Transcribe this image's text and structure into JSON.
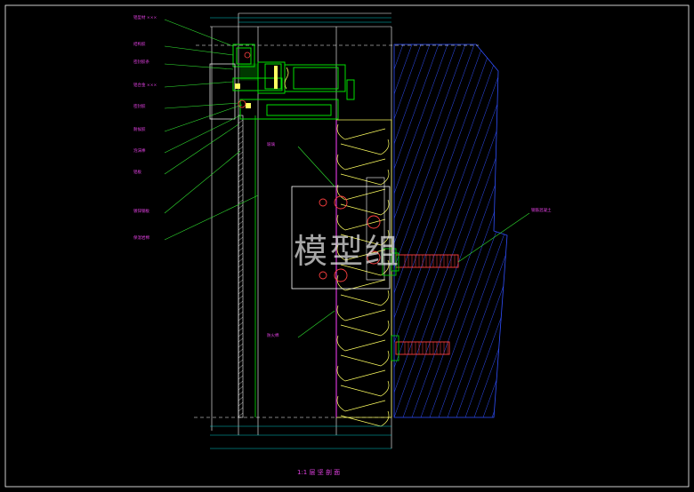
{
  "drawing": {
    "title": "1:1 层 坚 剖 面",
    "watermark": "模型组",
    "annotations": [
      "铝型材 ×××",
      "结构胶",
      "密封胶条",
      "铝合金 ×××",
      "密封胶",
      "耐候胶",
      "泡沫棒",
      "铝板",
      "镀锌钢板",
      "保温岩棉",
      "玻璃",
      "防火棉"
    ],
    "right_label": "钢筋混凝土",
    "colors": {
      "background": "#000000",
      "frame": "#ffffff",
      "aluminum": "#00e000",
      "annotation": "#e040e0",
      "leader": "#30e030",
      "hatch": "#3050ff",
      "dimension": "#00c8c8",
      "insulation": "#ffff60",
      "bolt": "#ff4040"
    }
  }
}
